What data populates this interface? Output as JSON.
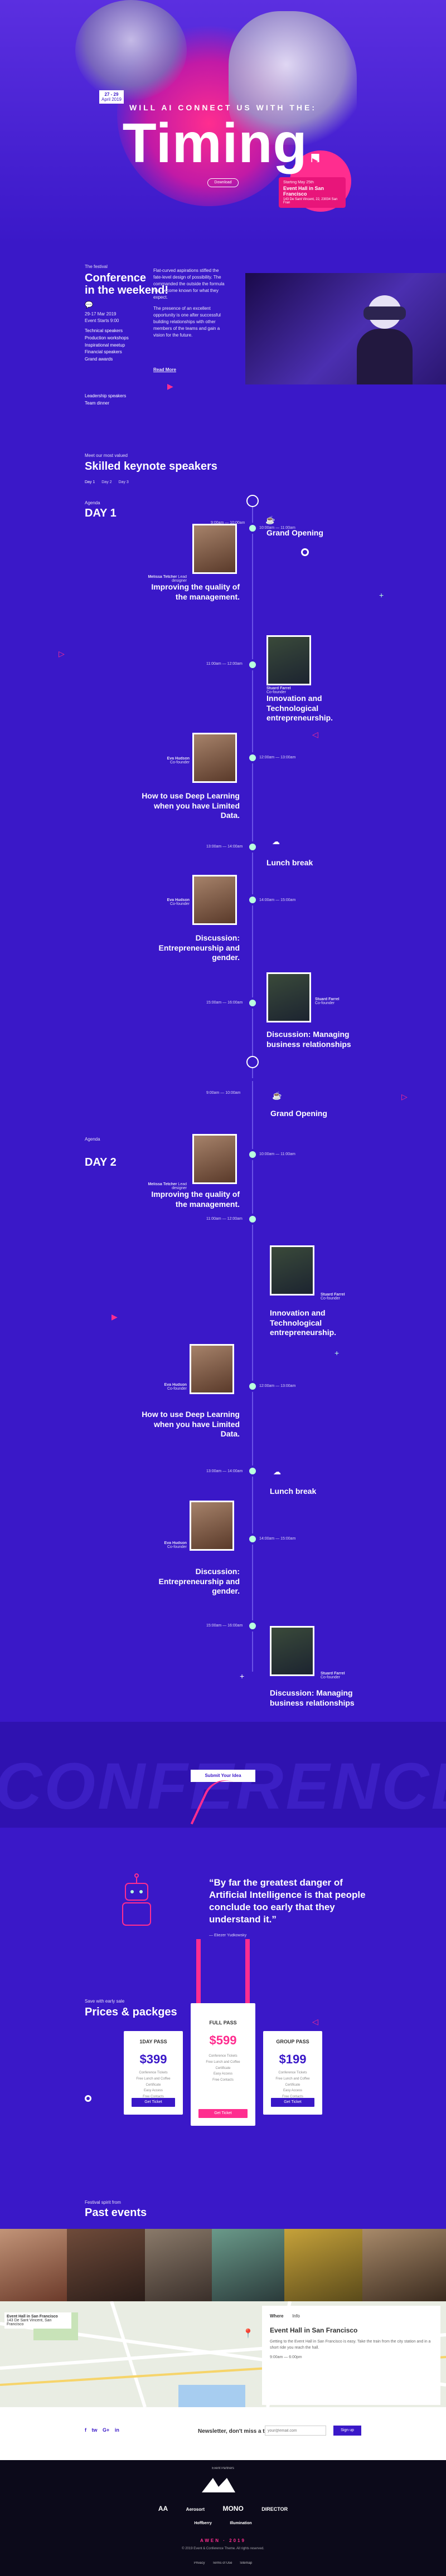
{
  "hero": {
    "kicker": "WILL AI CONNECT US WITH THE:",
    "title": "Timing.",
    "date_badge": "27 - 29",
    "date_sub": "April 2019",
    "card_line1": "Event Hall in San Francisco",
    "card_line2": "143 De Sant Vincent, 22, 23034 San Fran",
    "card_date": "Starting May 25th",
    "button": "Download"
  },
  "weekend": {
    "kicker": "The festival",
    "title_line1": "Conference",
    "title_line2": "in the weekend!",
    "info": [
      "29-17 Mar 2019",
      "Event Starts 9:00"
    ],
    "topics": [
      "Technical speakers",
      "Production workshops",
      "Inspirational meetup",
      "Financial speakers",
      "Grand awards"
    ],
    "extra": [
      "Leadership speakers",
      "Team dinner"
    ],
    "para1": "Flat-curved aspirations stifled the fate-level design of possibility. The commanded the outside the formula has become known for what they expect.",
    "para2": "The presence of an excellent opportunity is one after successful building relationships with other members of the teams and gain a vision for the future.",
    "read_more": "Read More"
  },
  "speakers": {
    "kicker": "Meet our most valued",
    "title": "Skilled keynote speakers",
    "tabs": [
      "Day 1",
      "Day 2",
      "Day 3"
    ]
  },
  "day1": {
    "kicker": "Agenda",
    "title": "DAY 1",
    "items": [
      {
        "time": "9:00am — 10:00am",
        "title": "Grand Opening",
        "side": "right",
        "speaker": "",
        "role": ""
      },
      {
        "time": "10:00am — 11:00am",
        "title": "Improving the quality of the management.",
        "side": "left",
        "speaker": "Melissa Tetcher",
        "role": "Lead designer"
      },
      {
        "time": "11:00am — 12:00am",
        "title": "Innovation and Technological entrepreneurship.",
        "side": "right",
        "speaker": "Stuard Farrel",
        "role": "Co-founder"
      },
      {
        "time": "12:00am — 13:00am",
        "title": "How to use Deep Learning when you have Limited Data.",
        "side": "left",
        "speaker": "Eva Hudson",
        "role": "Co-founder"
      },
      {
        "time": "13:00am — 14:00am",
        "title": "Lunch break",
        "side": "right",
        "speaker": "",
        "role": ""
      },
      {
        "time": "14:00am — 15:00am",
        "title": "Discussion: Entrepreneurship and gender.",
        "side": "left",
        "speaker": "Eva Hudson",
        "role": "Co-founder"
      },
      {
        "time": "15:00am — 16:00am",
        "title": "Discussion: Managing business relationships",
        "side": "right",
        "speaker": "Stuard Farrel",
        "role": "Co-founder"
      }
    ]
  },
  "day2": {
    "kicker": "Agenda",
    "title": "DAY 2",
    "items": [
      {
        "time": "9:00am — 10:00am",
        "title": "Grand Opening"
      },
      {
        "time": "10:00am — 11:00am",
        "title": "Improving the quality of the management.",
        "speaker": "Melissa Tetcher",
        "role": "Lead designer"
      },
      {
        "time": "11:00am — 12:00am",
        "title": "Innovation and Technological entrepreneurship.",
        "speaker": "Stuard Farrel",
        "role": "Co-founder"
      },
      {
        "time": "12:00am — 13:00am",
        "title": "How to use Deep Learning when you have Limited Data.",
        "speaker": "Eva Hudson",
        "role": "Co-founder"
      },
      {
        "time": "13:00am — 14:00am",
        "title": "Lunch break"
      },
      {
        "time": "14:00am — 15:00am",
        "title": "Discussion: Entrepreneurship and gender.",
        "speaker": "Eva Hudson",
        "role": "Co-founder"
      },
      {
        "time": "15:00am — 16:00am",
        "title": "Discussion: Managing business relationships",
        "speaker": "Stuard Farrel",
        "role": "Co-founder"
      }
    ]
  },
  "conference": {
    "watermark": "CONFERENCE",
    "button": "Submit Your Idea"
  },
  "quote": {
    "text": "“By far the greatest danger of Artificial Intelligence is that people conclude too early that they understand it.”",
    "author": "— Eliezer Yudkowsky"
  },
  "pricing": {
    "kicker": "Save with early sale",
    "title": "Prices & packges",
    "plans": [
      {
        "name": "1DAY PASS",
        "price": "$399",
        "lines": [
          "Conference Tickets",
          "Free Lunch and Coffee",
          "Certificate",
          "Easy Access",
          "Free Contacts"
        ],
        "button": "Get Ticket"
      },
      {
        "name": "FULL PASS",
        "price": "$599",
        "lines": [
          "Conference Tickets",
          "Free Lunch and Coffee",
          "Certificate",
          "Easy Access",
          "Free Contacts"
        ],
        "button": "Get Ticket"
      },
      {
        "name": "GROUP PASS",
        "price": "$199",
        "lines": [
          "Conference Tickets",
          "Free Lunch and Coffee",
          "Certificate",
          "Easy Access",
          "Free Contacts"
        ],
        "button": "Get Ticket"
      }
    ]
  },
  "past": {
    "kicker": "Festival spirit from",
    "title": "Past events"
  },
  "map": {
    "place_title": "Event Hall in San Francisco",
    "place_addr": "143 De Sant Vincent, San Francisco",
    "tab1": "Where",
    "tab2": "Info",
    "panel_title": "Event Hall in San Francisco",
    "panel_text": "Getting to the Event Hall in San Francisco is easy. Take the train from the city station and in a short ride you reach the hall.",
    "hours": "9:00am — 6:00pm"
  },
  "newsletter": {
    "social": [
      "f",
      "tw",
      "G+",
      "in"
    ],
    "label": "Newsletter, don't miss a thing!",
    "placeholder": "your@email.com",
    "button": "Sign up"
  },
  "footer": {
    "caption": "Event Partners",
    "logos": [
      "AA",
      "Aerosort",
      "MONO",
      "DIRECTOR",
      "Hoffberry",
      "Illumination"
    ],
    "brand": "AWEN · 2019",
    "credit": "© 2019 Event & Conference Theme. All rights reserved.",
    "links": [
      "Privacy",
      "Terms of Use",
      "Sitemap"
    ]
  }
}
